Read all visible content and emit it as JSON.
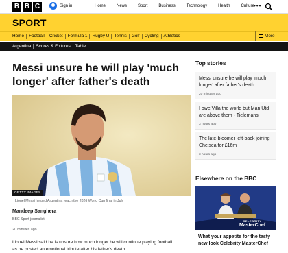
{
  "brand": {
    "letters": [
      "B",
      "B",
      "C"
    ]
  },
  "account": {
    "signin_label": "Sign in"
  },
  "topnav": {
    "items": [
      "Home",
      "News",
      "Sport",
      "Business",
      "Technology",
      "Health",
      "Culture"
    ]
  },
  "section": {
    "title": "SPORT"
  },
  "sportnav": {
    "items": [
      "Home",
      "Football",
      "Cricket",
      "Formula 1",
      "Rugby U",
      "Tennis",
      "Golf",
      "Cycling",
      "Athletics"
    ],
    "more_label": "More"
  },
  "breadcrumb": {
    "items": [
      "Argentina",
      "Scores & Fixtures",
      "Table"
    ]
  },
  "article": {
    "headline": "Messi unsure he will play 'much longer' after father's death",
    "image_credit": "GETTY IMAGES",
    "image_caption": "Lionel Messi helped Argentina reach the 2026 World Cup final in July",
    "author": "Mandeep Sanghera",
    "author_role": "BBC Sport journalist",
    "published": "20 minutes ago",
    "lede": "Lionel Messi said he is unsure how much longer he will continue playing football as he posted an emotional tribute after his father's death."
  },
  "top_stories": {
    "heading": "Top stories",
    "items": [
      {
        "title": "Messi unsure he will play 'much longer' after father's death",
        "time": "20 minutes ago"
      },
      {
        "title": "I owe Villa the world but Man Utd are above them - Tielemans",
        "time": "3 hours ago"
      },
      {
        "title": "The late-bloomer left-back joining Chelsea for £16m",
        "time": "3 hours ago"
      }
    ]
  },
  "elsewhere": {
    "heading": "Elsewhere on the BBC",
    "promo_logo_top": "CELEBRITY",
    "promo_logo_main": "MasterChef",
    "promo_title": "What your appetite for the tasty new look Celebrity MasterChef"
  },
  "colors": {
    "sport_yellow": "#ffd230",
    "breadcrumb_bg": "#141414"
  },
  "icons": {
    "search": "search-icon",
    "more_menu": "menu-icon",
    "overflow": "dots-icon"
  }
}
